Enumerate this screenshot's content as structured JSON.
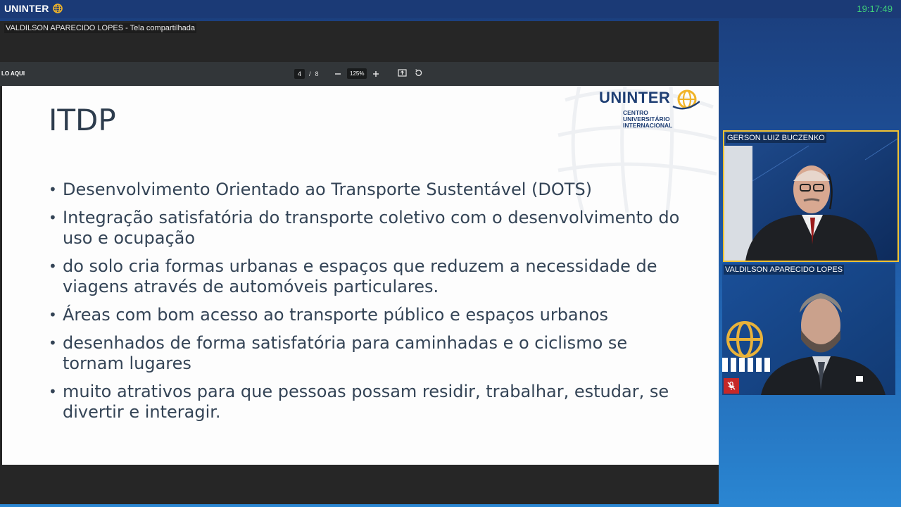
{
  "app": {
    "logo_text": "UNINTER",
    "clock": "19:17:49"
  },
  "share": {
    "label": "VALDILSON APARECIDO LOPES - Tela compartilhada"
  },
  "pdf_toolbar": {
    "file_name": "LO AQUI",
    "current_page": "4",
    "separator": "/",
    "total_pages": "8",
    "zoom": "125%",
    "zoom_out_icon": "minus-icon",
    "zoom_in_icon": "plus-icon",
    "fit_icon": "fit-page-icon",
    "rotate_icon": "rotate-icon"
  },
  "slide": {
    "title": "ITDP",
    "logo": {
      "name": "UNINTER",
      "line1": "CENTRO",
      "line2": "UNIVERSITÁRIO",
      "line3": "INTERNACIONAL"
    },
    "bullets": [
      "Desenvolvimento Orientado ao Transporte Sustentável (DOTS)",
      "Integração satisfatória do transporte coletivo com o desenvolvimento do uso e ocupação",
      "do solo cria formas urbanas e espaços que reduzem a necessidade de viagens através de automóveis particulares.",
      "Áreas com bom acesso ao transporte público e espaços urbanos",
      "desenhados de forma satisfatória para caminhadas e o ciclismo se tornam lugares",
      "muito atrativos para que pessoas possam residir, trabalhar, estudar, se divertir e interagir."
    ]
  },
  "participants": [
    {
      "name": "GERSON LUIZ BUCZENKO",
      "active_speaker": true
    },
    {
      "name": "VALDILSON APARECIDO LOPES",
      "muted": true
    }
  ],
  "colors": {
    "active_border": "#f1c232",
    "clock": "#3fd07a",
    "muted": "#c62828"
  }
}
